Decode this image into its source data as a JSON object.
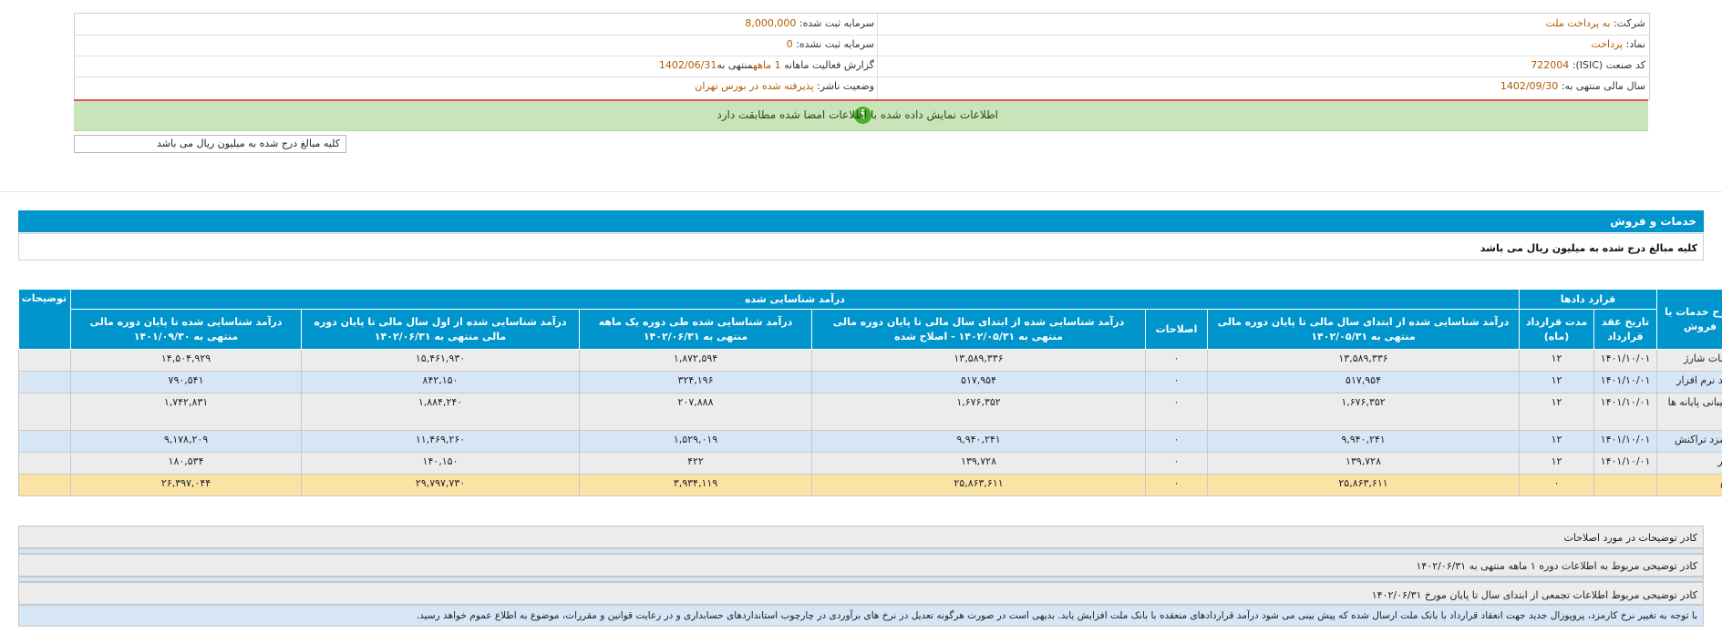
{
  "info": {
    "company_label": "شرکت:",
    "company_value": "به پرداخت ملت",
    "registered_capital_label": "سرمایه ثبت شده:",
    "registered_capital_value": "8,000,000",
    "symbol_label": "نماد:",
    "symbol_value": "پرداخت",
    "unregistered_capital_label": "سرمایه ثبت نشده:",
    "unregistered_capital_value": "0",
    "isic_label": "کد صنعت (ISIC):",
    "isic_value": "722004",
    "report_label": "گزارش فعالیت ماهانه",
    "report_value": "1 ماهه",
    "report_suffix": "منتهی به",
    "report_date": "1402/06/31",
    "fiscal_year_label": "سال مالی منتهی به:",
    "fiscal_year_value": "1402/09/30",
    "publisher_status_label": "وضعیت ناشر:",
    "publisher_status_value": "پذیرفته شده در بورس تهران"
  },
  "notice": {
    "text": "اطلاعات نمایش داده شده با اطلاعات امضا شده مطابقت دارد",
    "icon": "info-icon"
  },
  "units_note": "کلیه مبالغ درج شده به میلیون ریال می باشد",
  "section": {
    "title": "خدمات و فروش",
    "subtitle": "کلیه مبالغ درج شده به میلیون ریال می باشد"
  },
  "table": {
    "group_headers": {
      "desc": "شرح خدمات یا فروش",
      "contracts": "قرارد دادها",
      "recognized": "درآمد شناسایی شده",
      "notes": "توضیحات"
    },
    "sub_headers": {
      "contract_date": "تاریخ عقد قرارداد",
      "contract_duration": "مدت قرارداد (ماه)",
      "revenue_fy_start": "درآمد شناسایی شده از ابتدای سال مالی تا پایان دوره مالی منتهی به ۱۴۰۲/۰۵/۳۱",
      "corrections": "اصلاحات",
      "revenue_corrected": "درآمد شناسایی شده از ابتدای سال مالی تا پایان دوره مالی منتهی به ۱۴۰۲/۰۵/۳۱ - اصلاح شده",
      "revenue_one_month": "درآمد شناسایی شده طی دوره یک ماهه منتهی به ۱۴۰۲/۰۶/۳۱",
      "revenue_fy_to_period": "درآمد شناسایی شده از اول سال مالی تا پایان دوره مالی منتهی به ۱۴۰۲/۰۶/۳۱",
      "revenue_prev_period": "درآمد شناسایی شده تا پایان دوره مالی منتهی به ۱۴۰۱/۰۹/۳۰"
    },
    "rows": [
      {
        "name": "خدمات شارژ",
        "date": "۱۴۰۱/۱۰/۰۱",
        "duration": "۱۲",
        "rev1": "۱۳,۵۸۹,۳۳۶",
        "corr": "۰",
        "rev2": "۱۳,۵۸۹,۳۳۶",
        "rev3": "۱,۸۷۲,۵۹۴",
        "rev4": "۱۵,۴۶۱,۹۳۰",
        "rev5": "۱۴,۵۰۴,۹۲۹",
        "notes": ""
      },
      {
        "name": "تولید نرم افزار",
        "date": "۱۴۰۱/۱۰/۰۱",
        "duration": "۱۲",
        "rev1": "۵۱۷,۹۵۴",
        "corr": "۰",
        "rev2": "۵۱۷,۹۵۴",
        "rev3": "۳۲۴,۱۹۶",
        "rev4": "۸۴۲,۱۵۰",
        "rev5": "۷۹۰,۵۴۱",
        "notes": ""
      },
      {
        "name": "پشتیبانی پایانه ها",
        "date": "۱۴۰۱/۱۰/۰۱",
        "duration": "۱۲",
        "rev1": "۱,۶۷۶,۳۵۲",
        "corr": "۰",
        "rev2": "۱,۶۷۶,۳۵۲",
        "rev3": "۲۰۷,۸۸۸",
        "rev4": "۱,۸۸۴,۲۴۰",
        "rev5": "۱,۷۴۲,۸۳۱",
        "notes": ""
      },
      {
        "name": "کارمزد تراکنش",
        "date": "۱۴۰۱/۱۰/۰۱",
        "duration": "۱۲",
        "rev1": "۹,۹۴۰,۲۴۱",
        "corr": "۰",
        "rev2": "۹,۹۴۰,۲۴۱",
        "rev3": "۱,۵۲۹,۰۱۹",
        "rev4": "۱۱,۴۶۹,۲۶۰",
        "rev5": "۹,۱۷۸,۲۰۹",
        "notes": ""
      },
      {
        "name": "سایر",
        "date": "۱۴۰۱/۱۰/۰۱",
        "duration": "۱۲",
        "rev1": "۱۳۹,۷۲۸",
        "corr": "۰",
        "rev2": "۱۳۹,۷۲۸",
        "rev3": "۴۲۲",
        "rev4": "۱۴۰,۱۵۰",
        "rev5": "۱۸۰,۵۳۴",
        "notes": ""
      }
    ],
    "total": {
      "name": "جمع",
      "date": "",
      "duration": "۰",
      "rev1": "۲۵,۸۶۳,۶۱۱",
      "corr": "۰",
      "rev2": "۲۵,۸۶۳,۶۱۱",
      "rev3": "۳,۹۳۴,۱۱۹",
      "rev4": "۲۹,۷۹۷,۷۳۰",
      "rev5": "۲۶,۳۹۷,۰۴۴",
      "notes": ""
    }
  },
  "notes": {
    "corrections": "کادر توضیحات در مورد اصلاحات",
    "one_month": "کادر توضیحی مربوط به اطلاعات دوره ۱ ماهه منتهی به ۱۴۰۲/۰۶/۳۱",
    "cumulative": "کادر توضیحی مربوط اطلاعات تجمعی از ابتدای سال تا پایان مورخ ۱۴۰۲/۰۶/۳۱",
    "body": "با توجه به تغییر نرخ کارمزد، پروپوزال جدید جهت انعقاد قرارداد با بانک ملت ارسال شده که پیش بینی می شود درآمد قراردادهای منعقده با بانک ملت افزایش یابد. بدیهی است در صورت هرگونه تعدیل در نرخ های برآوردی در چارچوب استانداردهای حسابداری و در رعایت قوانین و مقررات، موضوع به اطلاع عموم خواهد رسید."
  },
  "colors": {
    "header_blue": "#0095cc",
    "row_gray": "#ececec",
    "row_blue": "#d6e6f5",
    "total_yellow": "#fbe3a6",
    "notice_green": "#c9e4b8",
    "value_orange": "#b35a00"
  }
}
